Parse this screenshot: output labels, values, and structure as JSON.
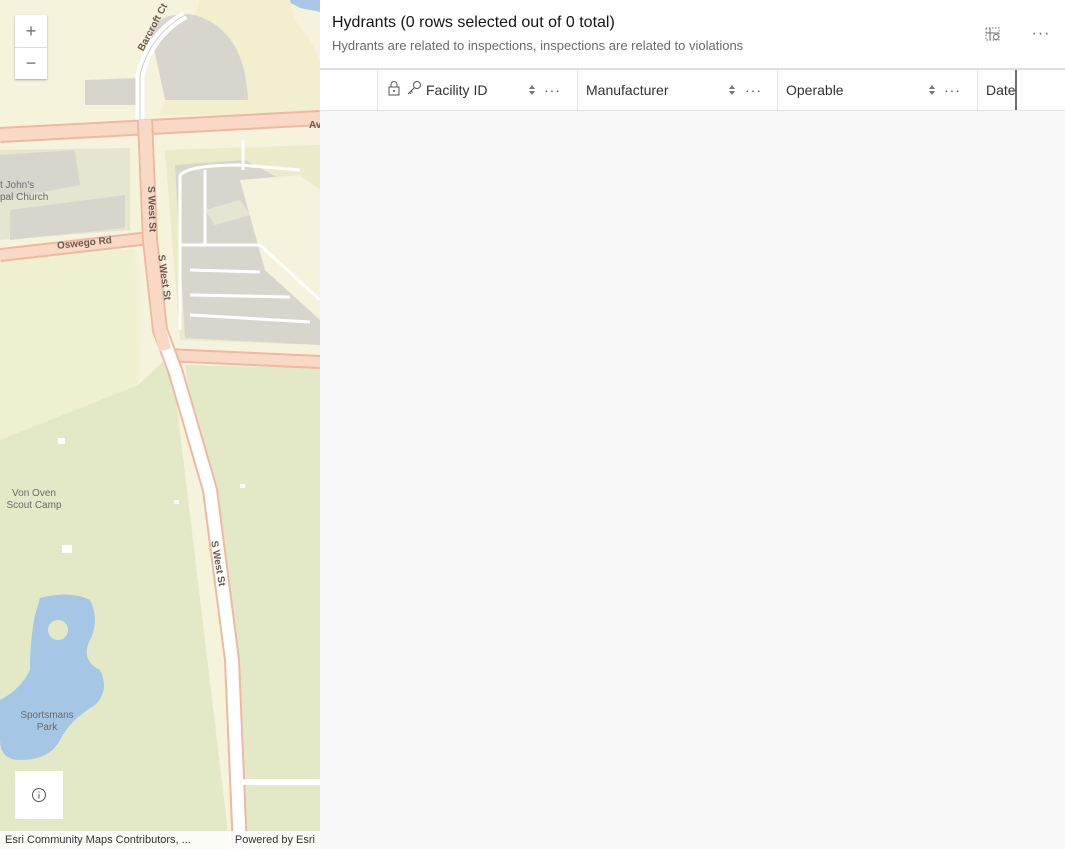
{
  "map": {
    "zoom_in": "+",
    "zoom_out": "−",
    "labels": {
      "church_line1": "t John's",
      "church_line2": "pal Church",
      "oswego": "Oswego Rd",
      "barcroft": "Barcroft Ct",
      "av": "Av",
      "swest1": "S West St",
      "swest2": "S West St",
      "swest3": "S West St",
      "scout_line1": "Von Oven",
      "scout_line2": "Scout Camp",
      "park_line1": "Sportsmans",
      "park_line2": "Park"
    },
    "attribution_left": "Esri Community Maps Contributors, ...",
    "attribution_right": "Powered by Esri"
  },
  "table": {
    "title": "Hydrants (0 rows selected out of 0 total)",
    "subtitle": "Hydrants are related to inspections, inspections are related to violations",
    "columns": [
      "Facility ID",
      "Manufacturer",
      "Operable",
      "Date"
    ],
    "more_label": "···"
  }
}
